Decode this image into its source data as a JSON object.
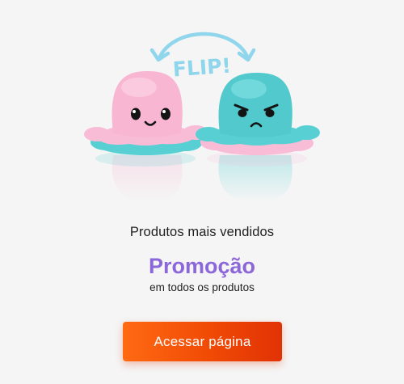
{
  "hero": {
    "flip_text": "FLIP!",
    "image": "reversible-octopus-plush",
    "colors": {
      "pink": "#f9bcd6",
      "teal": "#58d0d3",
      "arrow": "#8fd6ec"
    }
  },
  "headline": "Produtos mais vendidos",
  "promo": {
    "title": "Promoção",
    "subtitle": "em todos os produtos",
    "color": "#8b67d9"
  },
  "cta": {
    "label": "Acessar página",
    "color": "#f04a05"
  }
}
